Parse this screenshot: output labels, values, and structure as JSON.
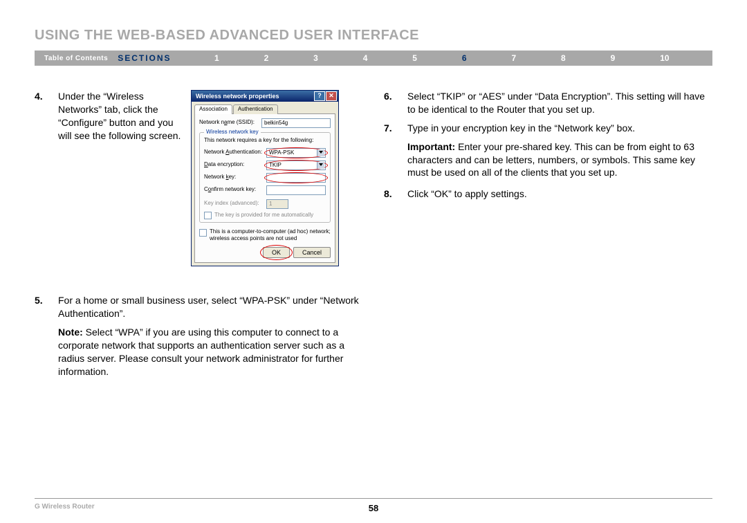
{
  "title": "USING THE WEB-BASED ADVANCED USER INTERFACE",
  "nav": {
    "toc": "Table of Contents",
    "sections_label": "SECTIONS",
    "links": [
      "1",
      "2",
      "3",
      "4",
      "5",
      "6",
      "7",
      "8",
      "9",
      "10"
    ],
    "active": "6"
  },
  "left": {
    "step4": {
      "num": "4.",
      "text": "Under the “Wireless Networks” tab, click the “Configure” button and you will see the following screen."
    },
    "step5": {
      "num": "5.",
      "text": "For a home or small business user, select “WPA-PSK” under “Network Authentication”."
    },
    "note_label": "Note:",
    "note_text": " Select “WPA” if you are using this computer to connect to a corporate network that supports an authentication server such as a radius server. Please consult your network administrator for further information."
  },
  "right": {
    "step6": {
      "num": "6.",
      "text": "Select “TKIP” or “AES” under “Data Encryption”. This setting will have to be identical to the Router that you set up."
    },
    "step7": {
      "num": "7.",
      "text": "Type in your encryption key in the “Network key” box."
    },
    "important_label": "Important:",
    "important_text": " Enter your pre-shared key. This can be from eight to 63 characters and can be letters, numbers, or symbols. This same key must be used on all of the clients that you set up.",
    "step8": {
      "num": "8.",
      "text": "Click “OK” to apply settings."
    }
  },
  "dialog": {
    "title": "Wireless network properties",
    "tabs": {
      "assoc": "Association",
      "auth": "Authentication"
    },
    "labels": {
      "ssid": "Network name (SSID):",
      "group": "Wireless network key",
      "req": "This network requires a key for the following:",
      "auth": "Network Authentication:",
      "enc": "Data encryption:",
      "key": "Network key:",
      "confirm": "Confirm network key:",
      "idx": "Key index (advanced):",
      "auto": "The key is provided for me automatically",
      "adhoc": "This is a computer-to-computer (ad hoc) network; wireless access points are not used"
    },
    "values": {
      "ssid": "belkin54g",
      "auth": "WPA-PSK",
      "enc": "TKIP",
      "idx": "1"
    },
    "buttons": {
      "ok": "OK",
      "cancel": "Cancel"
    }
  },
  "footer": {
    "product": "G Wireless Router",
    "page": "58"
  }
}
